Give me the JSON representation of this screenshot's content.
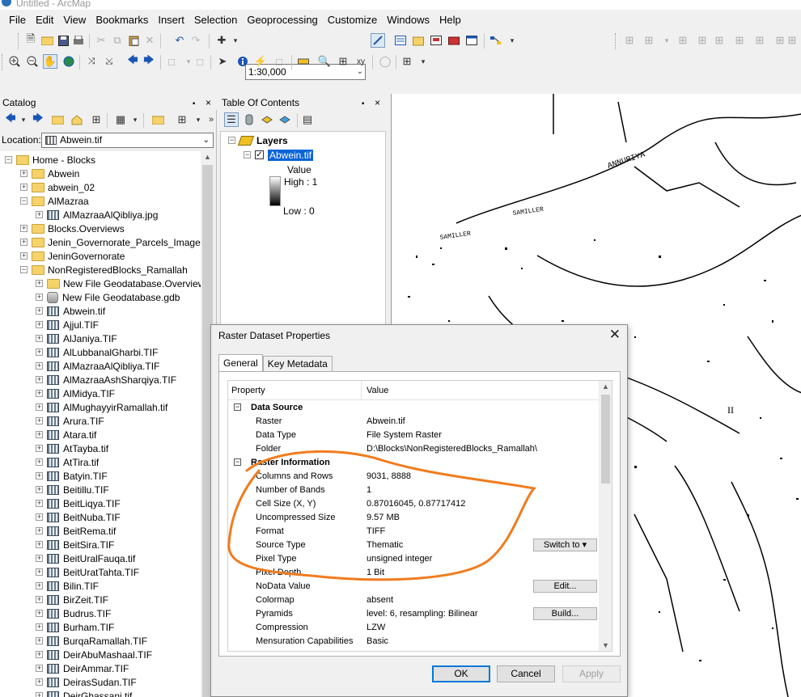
{
  "window": {
    "title": "Untitled - ArcMap"
  },
  "menu": [
    "File",
    "Edit",
    "View",
    "Bookmarks",
    "Insert",
    "Selection",
    "Geoprocessing",
    "Customize",
    "Windows",
    "Help"
  ],
  "toolbar": {
    "scale": "1:30,000"
  },
  "catalog": {
    "title": "Catalog",
    "pin": "⌂",
    "close": "×",
    "location_label": "Location:",
    "location_value": "Abwein.tif",
    "tree": [
      {
        "label": "Home - Blocks",
        "icon": "home-folder",
        "level": 0,
        "expander": "−"
      },
      {
        "label": "Abwein",
        "icon": "folder",
        "level": 1,
        "expander": "+"
      },
      {
        "label": "abwein_02",
        "icon": "folder",
        "level": 1,
        "expander": "+"
      },
      {
        "label": "AlMazraa",
        "icon": "folder",
        "level": 1,
        "expander": "−"
      },
      {
        "label": "AlMazraaAlQibliya.jpg",
        "icon": "raster",
        "level": 2,
        "expander": "+"
      },
      {
        "label": "Blocks.Overviews",
        "icon": "folder",
        "level": 1,
        "expander": "+"
      },
      {
        "label": "Jenin_Governorate_Parcels_Images",
        "icon": "folder",
        "level": 1,
        "expander": "+"
      },
      {
        "label": "JeninGovernorate",
        "icon": "folder",
        "level": 1,
        "expander": "+"
      },
      {
        "label": "NonRegisteredBlocks_Ramallah",
        "icon": "folder",
        "level": 1,
        "expander": "−"
      },
      {
        "label": "New File Geodatabase.Overview",
        "icon": "folder",
        "level": 2,
        "expander": "+"
      },
      {
        "label": "New File Geodatabase.gdb",
        "icon": "gdb",
        "level": 2,
        "expander": "+"
      },
      {
        "label": "Abwein.tif",
        "icon": "raster",
        "level": 2,
        "expander": "+"
      },
      {
        "label": "Ajjul.TIF",
        "icon": "raster",
        "level": 2,
        "expander": "+"
      },
      {
        "label": "AlJaniya.TIF",
        "icon": "raster",
        "level": 2,
        "expander": "+"
      },
      {
        "label": "AlLubbanalGharbi.TIF",
        "icon": "raster",
        "level": 2,
        "expander": "+"
      },
      {
        "label": "AlMazraaAlQibliya.TIF",
        "icon": "raster",
        "level": 2,
        "expander": "+"
      },
      {
        "label": "AlMazraaAshSharqiya.TIF",
        "icon": "raster",
        "level": 2,
        "expander": "+"
      },
      {
        "label": "AlMidya.TIF",
        "icon": "raster",
        "level": 2,
        "expander": "+"
      },
      {
        "label": "AlMughayyirRamallah.tif",
        "icon": "raster",
        "level": 2,
        "expander": "+"
      },
      {
        "label": "Arura.TIF",
        "icon": "raster",
        "level": 2,
        "expander": "+"
      },
      {
        "label": "Atara.tif",
        "icon": "raster",
        "level": 2,
        "expander": "+"
      },
      {
        "label": "AtTayba.tif",
        "icon": "raster",
        "level": 2,
        "expander": "+"
      },
      {
        "label": "AtTira.tif",
        "icon": "raster",
        "level": 2,
        "expander": "+"
      },
      {
        "label": "Batyin.TIF",
        "icon": "raster",
        "level": 2,
        "expander": "+"
      },
      {
        "label": "Beitillu.TIF",
        "icon": "raster",
        "level": 2,
        "expander": "+"
      },
      {
        "label": "BeitLiqya.TIF",
        "icon": "raster",
        "level": 2,
        "expander": "+"
      },
      {
        "label": "BeitNuba.TIF",
        "icon": "raster",
        "level": 2,
        "expander": "+"
      },
      {
        "label": "BeitRema.tif",
        "icon": "raster",
        "level": 2,
        "expander": "+"
      },
      {
        "label": "BeitSira.TIF",
        "icon": "raster",
        "level": 2,
        "expander": "+"
      },
      {
        "label": "BeitUralFauqa.tif",
        "icon": "raster",
        "level": 2,
        "expander": "+"
      },
      {
        "label": "BeitUratTahta.TIF",
        "icon": "raster",
        "level": 2,
        "expander": "+"
      },
      {
        "label": "Bilin.TIF",
        "icon": "raster",
        "level": 2,
        "expander": "+"
      },
      {
        "label": "BirZeit.TIF",
        "icon": "raster",
        "level": 2,
        "expander": "+"
      },
      {
        "label": "Budrus.TIF",
        "icon": "raster",
        "level": 2,
        "expander": "+"
      },
      {
        "label": "Burham.TIF",
        "icon": "raster",
        "level": 2,
        "expander": "+"
      },
      {
        "label": "BurqaRamallah.TIF",
        "icon": "raster",
        "level": 2,
        "expander": "+"
      },
      {
        "label": "DeirAbuMashaal.TIF",
        "icon": "raster",
        "level": 2,
        "expander": "+"
      },
      {
        "label": "DeirAmmar.TIF",
        "icon": "raster",
        "level": 2,
        "expander": "+"
      },
      {
        "label": "DeirasSudan.TIF",
        "icon": "raster",
        "level": 2,
        "expander": "+"
      },
      {
        "label": "DeirGhassani.tif",
        "icon": "raster",
        "level": 2,
        "expander": "+"
      }
    ]
  },
  "toc": {
    "title": "Table Of Contents",
    "layers_label": "Layers",
    "layer_name": "Abwein.tif",
    "legend_value_label": "Value",
    "legend_high": "High : 1",
    "legend_low": "Low : 0"
  },
  "dialog": {
    "title": "Raster Dataset Properties",
    "tabs": [
      "General",
      "Key Metadata"
    ],
    "col_property": "Property",
    "col_value": "Value",
    "rows": [
      {
        "kind": "section",
        "name": "Data Source",
        "expander": "−"
      },
      {
        "kind": "item",
        "name": "Raster",
        "value": "Abwein.tif"
      },
      {
        "kind": "item",
        "name": "Data Type",
        "value": "File System Raster"
      },
      {
        "kind": "item",
        "name": "Folder",
        "value": "D:\\Blocks\\NonRegisteredBlocks_Ramallah\\"
      },
      {
        "kind": "section",
        "name": "Raster Information",
        "expander": "−"
      },
      {
        "kind": "item",
        "name": "Columns and Rows",
        "value": "9031, 8888"
      },
      {
        "kind": "item",
        "name": "Number of Bands",
        "value": "1"
      },
      {
        "kind": "item",
        "name": "Cell Size (X, Y)",
        "value": "0.87016045, 0.87717412"
      },
      {
        "kind": "item",
        "name": "Uncompressed Size",
        "value": "9.57 MB"
      },
      {
        "kind": "item",
        "name": "Format",
        "value": "TIFF"
      },
      {
        "kind": "item",
        "name": "Source Type",
        "value": "Thematic",
        "button": "Switch to ▾"
      },
      {
        "kind": "item",
        "name": "Pixel Type",
        "value": "unsigned integer"
      },
      {
        "kind": "item",
        "name": "Pixel Depth",
        "value": "1 Bit"
      },
      {
        "kind": "item",
        "name": "NoData Value",
        "value": "",
        "button": "Edit..."
      },
      {
        "kind": "item",
        "name": "Colormap",
        "value": "absent"
      },
      {
        "kind": "item",
        "name": "Pyramids",
        "value": "level: 6, resampling: Bilinear",
        "button": "Build..."
      },
      {
        "kind": "item",
        "name": "Compression",
        "value": "LZW"
      },
      {
        "kind": "item",
        "name": "Mensuration Capabilities",
        "value": "Basic"
      }
    ],
    "ok": "OK",
    "cancel": "Cancel",
    "apply": "Apply",
    "close": "✕"
  },
  "colors": {
    "selection": "#0a64d6",
    "annotation": "#f07c1e",
    "accent": "#0078d7"
  },
  "map": {
    "labels": [
      "ANNURIYA",
      "SAMILLER",
      "SAMILLER"
    ]
  }
}
